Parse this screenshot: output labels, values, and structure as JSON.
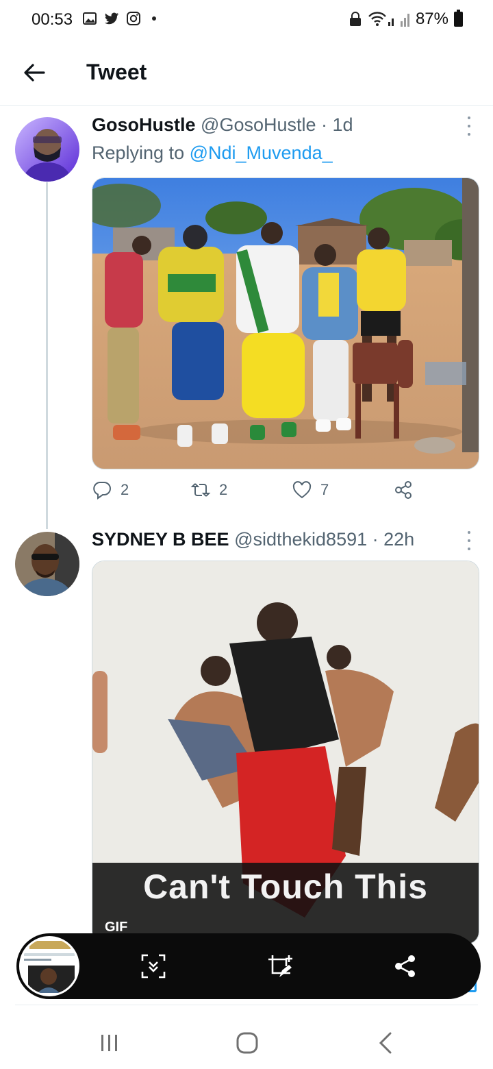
{
  "status_bar": {
    "time": "00:53",
    "battery": "87%",
    "left_icons": [
      "gallery-icon",
      "twitter-icon",
      "instagram-icon"
    ],
    "right_icons": [
      "lock-icon",
      "wifi-icon",
      "signal-icon",
      "battery-icon"
    ]
  },
  "header": {
    "title": "Tweet",
    "back_icon": "arrow-left-icon"
  },
  "tweets": [
    {
      "name": "GosoHustle",
      "handle": "@GosoHustle",
      "time": "· 1d",
      "replying_prefix": "Replying to ",
      "replying_to": "@Ndi_Muvenda_",
      "media_type": "photo",
      "replies": "2",
      "retweets": "2",
      "likes": "7"
    },
    {
      "name": "SYDNEY B BEE",
      "handle": "@sidthekid8591",
      "time": "· 22h",
      "media_type": "gif",
      "gif_caption": "Can't Touch This",
      "gif_badge": "GIF"
    }
  ],
  "screenshot_toolbar": {
    "buttons": [
      "scroll-capture-icon",
      "crop-edit-icon",
      "share-icon"
    ]
  },
  "navbar": {
    "buttons": [
      "recent-apps-icon",
      "home-icon",
      "back-icon"
    ]
  },
  "colors": {
    "accent": "#1d9bf0",
    "text": "#0f1419",
    "secondary": "#536471"
  }
}
